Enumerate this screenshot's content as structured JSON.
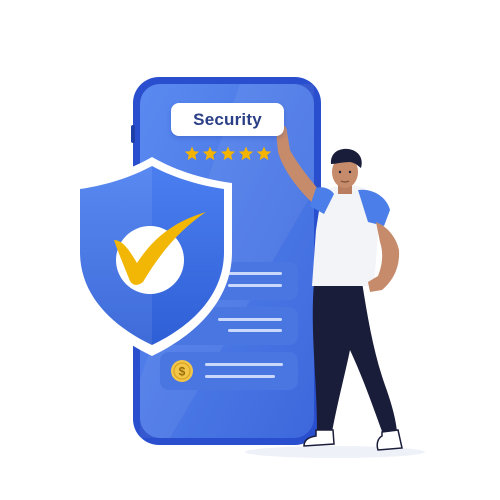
{
  "screen": {
    "title": "Security",
    "rating": 5,
    "rating_max": 5,
    "list_items": [
      {
        "icon": "text-lines-icon"
      },
      {
        "icon": "text-lines-icon"
      },
      {
        "icon": "dollar-coin-icon"
      }
    ]
  },
  "illustration": {
    "shield_icon": "shield-check-icon",
    "person": "man-pointing-at-phone"
  },
  "colors": {
    "phone_frame": "#2f55d4",
    "phone_screen": "#4f7de8",
    "shield": "#3c6ee0",
    "check": "#f2b705",
    "star": "#f5b400",
    "title_text": "#2b3f86",
    "shirt_sleeve": "#4b7ee8",
    "pants": "#1a1d3a"
  }
}
